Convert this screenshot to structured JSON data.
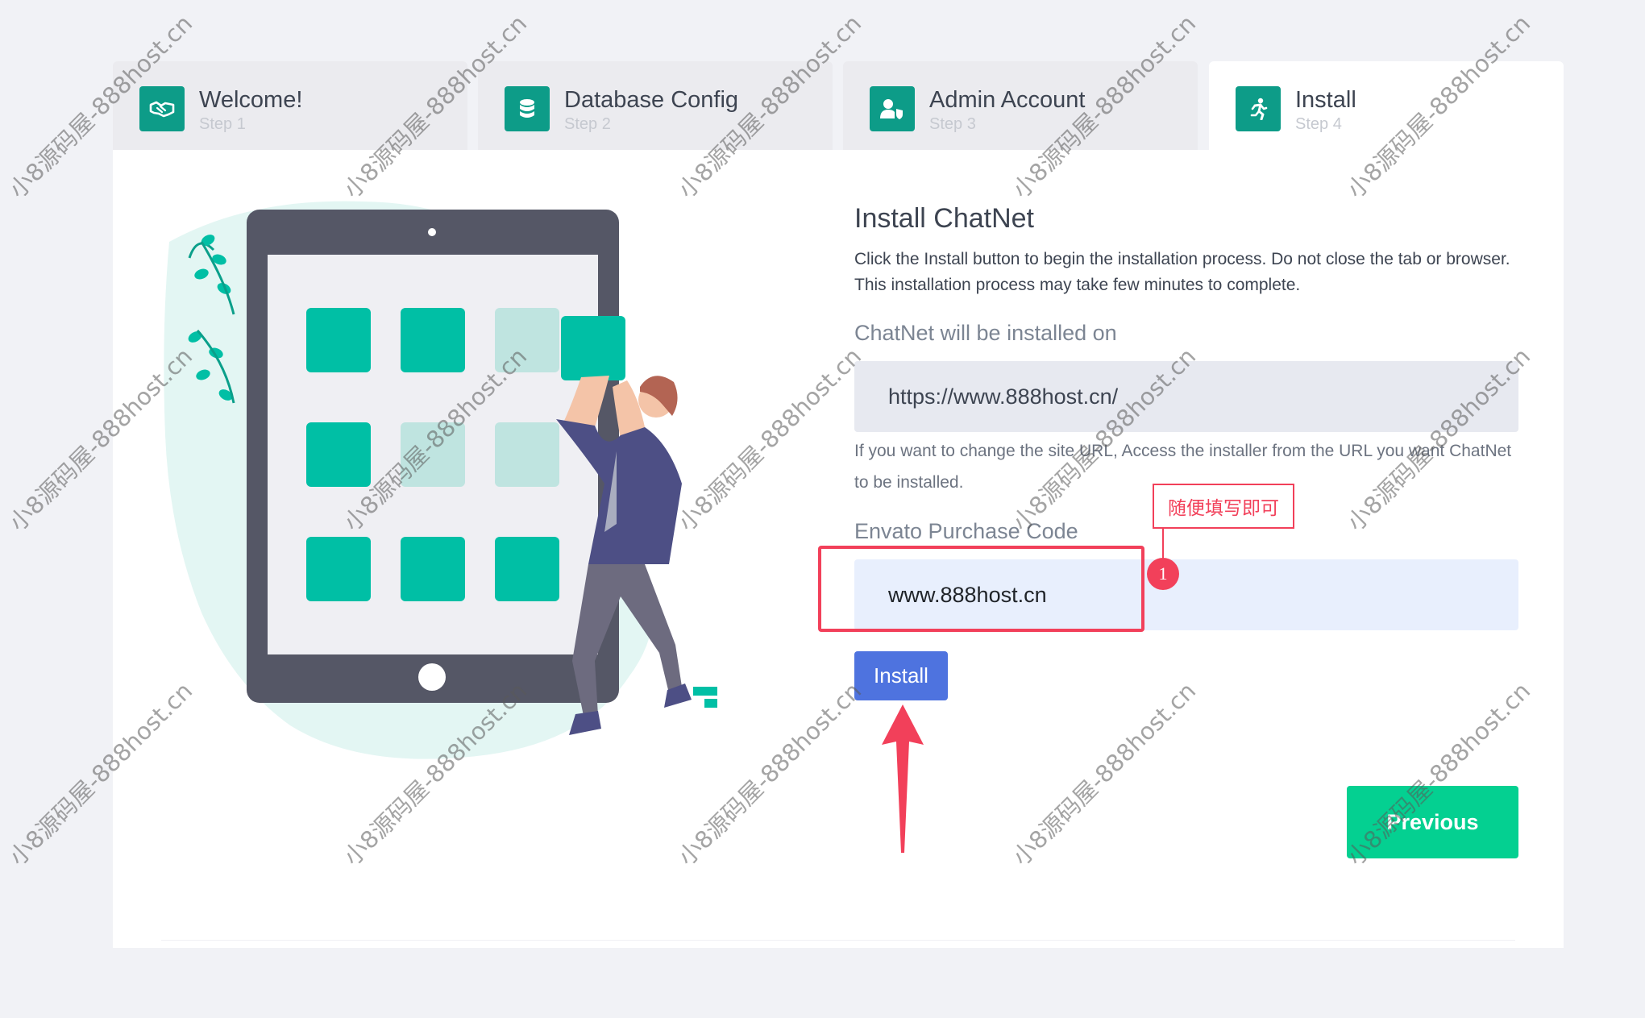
{
  "tabs": [
    {
      "title": "Welcome!",
      "step": "Step 1",
      "icon": "handshake-icon",
      "active": false
    },
    {
      "title": "Database Config",
      "step": "Step 2",
      "icon": "database-icon",
      "active": false
    },
    {
      "title": "Admin Account",
      "step": "Step 3",
      "icon": "user-shield-icon",
      "active": false
    },
    {
      "title": "Install",
      "step": "Step 4",
      "icon": "running-icon",
      "active": true
    }
  ],
  "main": {
    "title": "Install ChatNet",
    "description": "Click the Install button to begin the installation process. Do not close the tab or browser. This installation process may take few minutes to complete.",
    "url_label": "ChatNet will be installed on",
    "url_value": "https://www.888host.cn/",
    "url_help": "If you want to change the site URL, Access the installer from the URL you want ChatNet to be installed.",
    "code_label": "Envato Purchase Code",
    "code_value": "www.888host.cn",
    "install_label": "Install",
    "previous_label": "Previous"
  },
  "annotation": {
    "callout_text": "随便填写即可",
    "badge": "1"
  },
  "watermark": "小8源码屋-888host.cn",
  "colors": {
    "background": "#f1f2f6",
    "tab_inactive": "#ebebef",
    "icon_teal": "#0d9c88",
    "install_button": "#4e73df",
    "previous_button": "#04d091",
    "annotation_red": "#f2405a",
    "tile_teal": "#00bfa5"
  }
}
